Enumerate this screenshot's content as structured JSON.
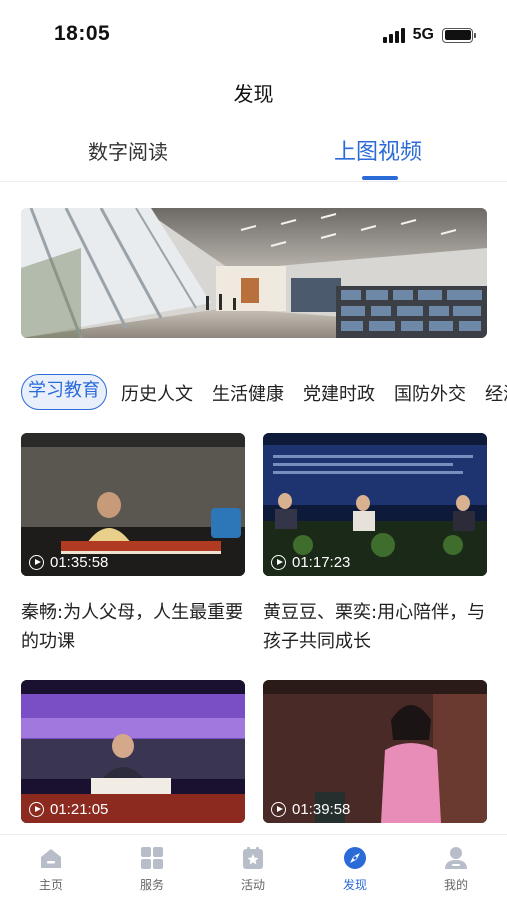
{
  "status_bar": {
    "time": "18:05",
    "network": "5G"
  },
  "page_title": "发现",
  "top_tabs": [
    {
      "label": "数字阅读",
      "active": false
    },
    {
      "label": "上图视频",
      "active": true
    }
  ],
  "categories": [
    {
      "label": "学习教育",
      "active": true
    },
    {
      "label": "历史人文"
    },
    {
      "label": "生活健康"
    },
    {
      "label": "党建时政"
    },
    {
      "label": "国防外交"
    },
    {
      "label": "经济"
    }
  ],
  "videos": [
    {
      "duration": "01:35:58",
      "title": "秦畅:为人父母，人生最重要的功课"
    },
    {
      "duration": "01:17:23",
      "title": "黄豆豆、栗奕:用心陪伴，与孩子共同成长"
    },
    {
      "duration": "01:21:05",
      "title": ""
    },
    {
      "duration": "01:39:58",
      "title": ""
    }
  ],
  "bottom_nav": [
    {
      "label": "主页",
      "icon": "home-icon"
    },
    {
      "label": "服务",
      "icon": "grid-icon"
    },
    {
      "label": "活动",
      "icon": "star-calendar-icon"
    },
    {
      "label": "发现",
      "icon": "compass-icon",
      "active": true
    },
    {
      "label": "我的",
      "icon": "user-icon"
    }
  ],
  "colors": {
    "accent": "#2a6bd8",
    "accent_bg": "#e9f0fc",
    "inactive": "#b8bec9"
  }
}
